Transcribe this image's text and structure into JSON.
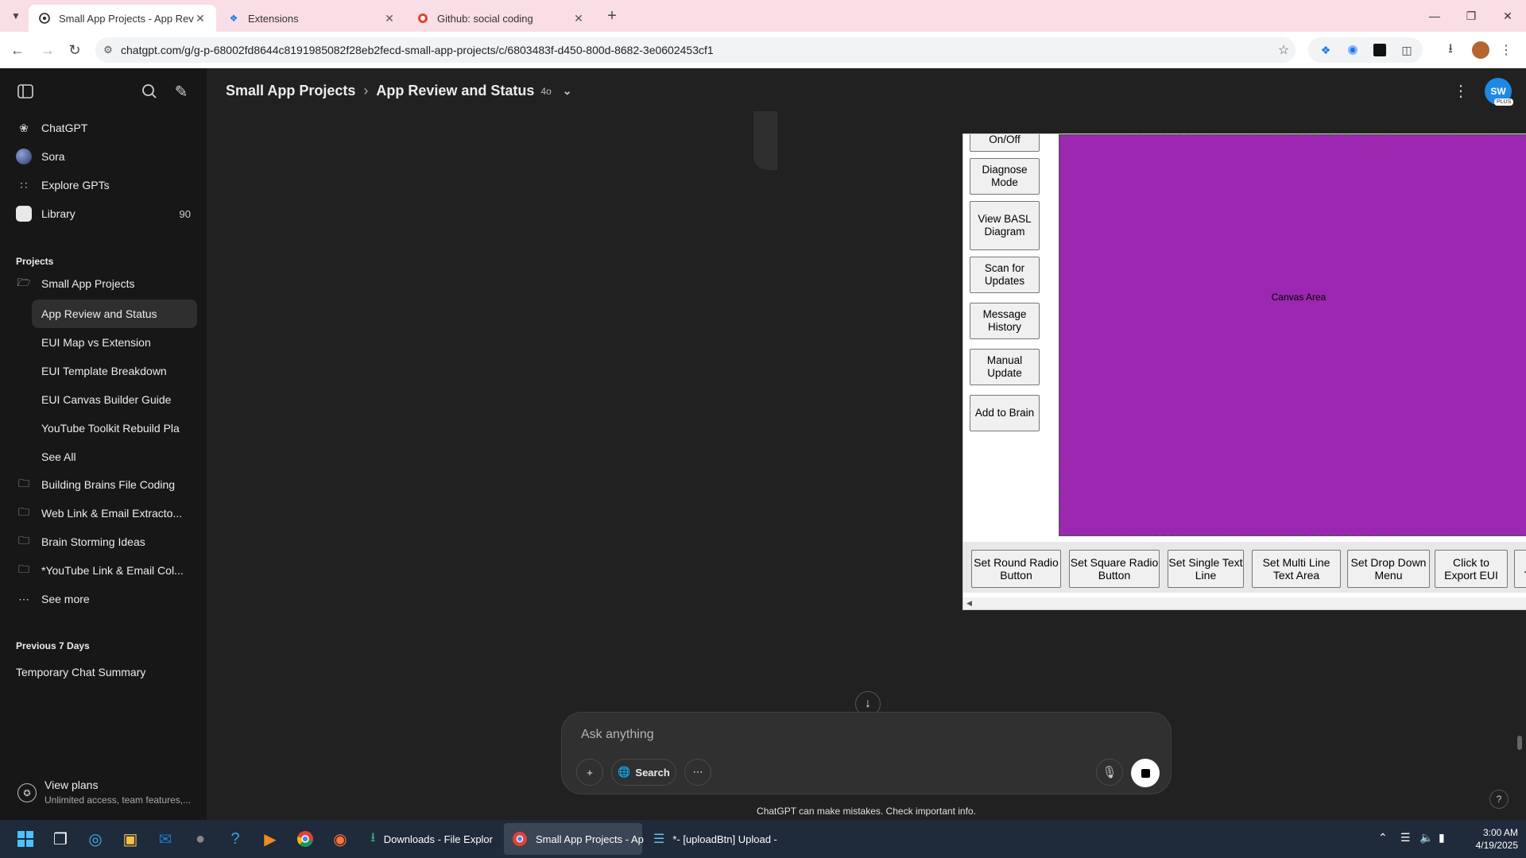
{
  "browser": {
    "tabs": [
      {
        "title": "Small App Projects - App Revie",
        "active": true,
        "icon": "chatgpt-icon"
      },
      {
        "title": "Extensions",
        "active": false,
        "icon": "puzzle-icon"
      },
      {
        "title": "Github: social coding",
        "active": false,
        "icon": "github-icon"
      }
    ],
    "url": "chatgpt.com/g/g-p-68002fd8644c8191985082f28eb2fecd-small-app-projects/c/6803483f-d450-800d-8682-3e0602453cf1"
  },
  "sidebar": {
    "top_items": [
      {
        "label": "ChatGPT",
        "icon": "chatgpt-icon"
      },
      {
        "label": "Sora",
        "icon": "sora-icon"
      },
      {
        "label": "Explore GPTs",
        "icon": "grid-icon"
      },
      {
        "label": "Library",
        "icon": "library-icon",
        "count": "90"
      }
    ],
    "projects_heading": "Projects",
    "projects": {
      "main": "Small App Projects",
      "chats": [
        "App Review and Status",
        "EUI Map vs Extension",
        "EUI Template Breakdown",
        "EUI Canvas Builder Guide",
        "YouTube Toolkit Rebuild Pla",
        "See All"
      ],
      "folders": [
        "Building Brains File Coding",
        "Web Link & Email Extracto...",
        "Brain Storming Ideas",
        "*YouTube Link & Email Col..."
      ],
      "see_more": "See more"
    },
    "previous_heading": "Previous 7 Days",
    "previous_chats": [
      "Temporary Chat Summary"
    ],
    "view_plans": {
      "title": "View plans",
      "subtitle": "Unlimited access, team features,..."
    }
  },
  "header": {
    "project": "Small App Projects",
    "chat": "App Review and Status",
    "model": "4o",
    "avatar": "SW",
    "avatar_badge": "PLUS"
  },
  "app": {
    "left_tools": [
      "On/Off",
      "Diagnose Mode",
      "View BASL Diagram",
      "Scan for Updates",
      "Message History",
      "Manual Update",
      "Add to Brain"
    ],
    "canvas_label": "Canvas Area",
    "canvas_color": "#9c27b0",
    "swatches": [
      "#ff9800",
      "#ffeb3b",
      "#cddc39",
      "#4caf50",
      "#00bcd4",
      "#2196f3",
      "#3f51b5",
      "#9c27b0",
      "#795548",
      "#000000"
    ],
    "bottom_tools": [
      "Set Round Radio Button",
      "Set Square Radio Button",
      "Set Single Text Line",
      "Set Multi Line Text Area",
      "Set Drop Down Menu",
      "Click to Export EUI",
      "Reset Template"
    ]
  },
  "composer": {
    "placeholder": "Ask anything",
    "search_label": "Search"
  },
  "disclaimer": "ChatGPT can make mistakes. Check important info.",
  "taskbar": {
    "apps": [
      {
        "label": "Downloads - File Explor",
        "icon": "download-icon"
      },
      {
        "label": "Small App Projects - Ap",
        "icon": "chrome-icon",
        "active": true
      },
      {
        "label": "*- [uploadBtn] Upload -",
        "icon": "notepad-icon"
      }
    ],
    "time": "3:00 AM",
    "date": "4/19/2025"
  }
}
